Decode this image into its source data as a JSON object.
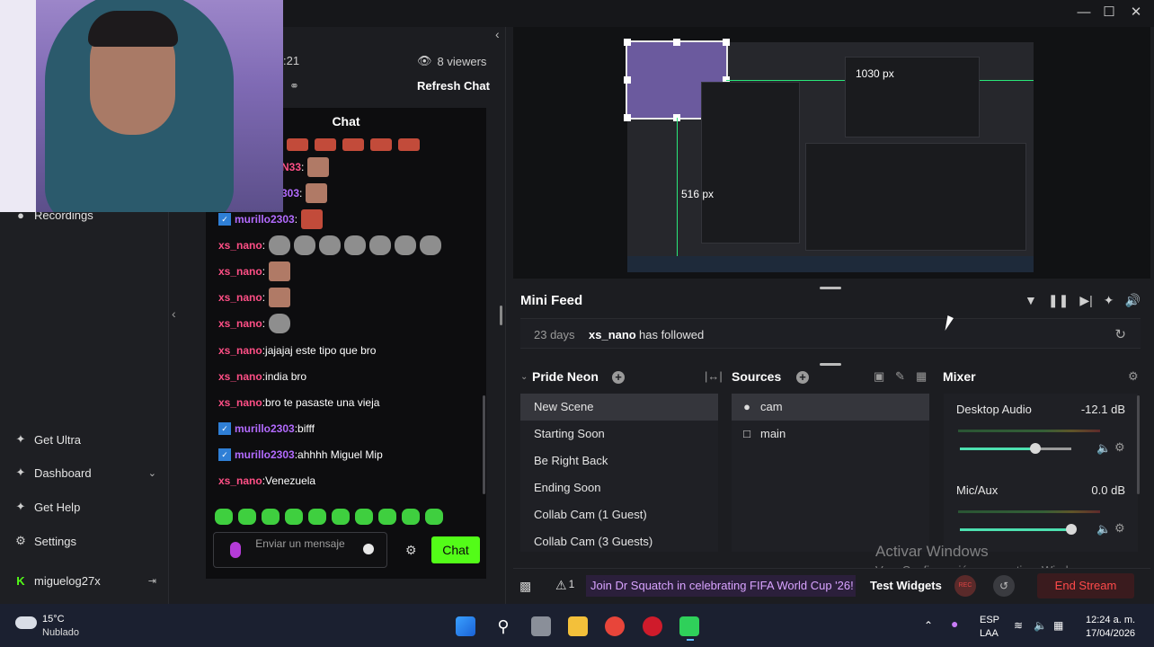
{
  "stream": {
    "time_fragment": ":21",
    "viewers": "8 viewers",
    "refresh_chat": "Refresh Chat"
  },
  "sidebar": {
    "items": [
      {
        "label": "Recordings",
        "icon": "record-icon"
      },
      {
        "label": "Get Ultra",
        "icon": "ultra-icon"
      },
      {
        "label": "Dashboard",
        "icon": "dashboard-icon"
      },
      {
        "label": "Get Help",
        "icon": "help-icon"
      },
      {
        "label": "Settings",
        "icon": "gear-icon"
      }
    ],
    "username": "miguelog27x"
  },
  "chat": {
    "title": "Chat",
    "messages": [
      {
        "user": "N33",
        "text": ""
      },
      {
        "user": "303",
        "text": ""
      },
      {
        "user": "murillo2303",
        "text": ""
      },
      {
        "user": "xs_nano",
        "text": ""
      },
      {
        "user": "xs_nano",
        "text": ""
      },
      {
        "user": "xs_nano",
        "text": ""
      },
      {
        "user": "xs_nano",
        "text": ""
      },
      {
        "user": "xs_nano",
        "text": "jajajaj este tipo que bro"
      },
      {
        "user": "xs_nano",
        "text": "india bro"
      },
      {
        "user": "xs_nano",
        "text": "bro te pasaste una vieja"
      },
      {
        "user": "murillo2303",
        "text": "bifff"
      },
      {
        "user": "murillo2303",
        "text": "ahhhh Miguel Mip"
      },
      {
        "user": "xs_nano",
        "text": "Venezuela"
      }
    ],
    "input_placeholder": "Enviar un mensaje",
    "send_label": "Chat"
  },
  "preview": {
    "label_width": "1030 px",
    "label_height": "516 px"
  },
  "mini_feed": {
    "title": "Mini Feed",
    "events": [
      {
        "time": "23 days",
        "user": "xs_nano",
        "action": "has followed"
      }
    ]
  },
  "scenes": {
    "title": "Pride Neon",
    "items": [
      "New Scene",
      "Starting Soon",
      "Be Right Back",
      "Ending Soon",
      "Collab Cam (1 Guest)",
      "Collab Cam (3 Guests)"
    ],
    "selected": "New Scene"
  },
  "sources": {
    "title": "Sources",
    "items": [
      {
        "label": "cam",
        "icon": "camera-icon"
      },
      {
        "label": "main",
        "icon": "monitor-icon"
      }
    ]
  },
  "mixer": {
    "title": "Mixer",
    "channels": [
      {
        "name": "Desktop Audio",
        "db": "-12.1 dB",
        "level": 0.68
      },
      {
        "name": "Mic/Aux",
        "db": "0.0 dB",
        "level": 1.0
      }
    ]
  },
  "bottom": {
    "alerts_count": "1",
    "ticker": "Join Dr Squatch in celebrating FIFA World Cup '26!",
    "test_widgets": "Test Widgets",
    "rec": "REC",
    "end_stream": "End Stream"
  },
  "watermark": {
    "title": "Activar Windows",
    "subtitle": "Ve a Configuración para activar Windows."
  },
  "taskbar": {
    "temperature": "15°C",
    "weather": "Nublado",
    "lang1": "ESP",
    "lang2": "LAA",
    "time": "12:24 a. m.",
    "date": "17/04/2026"
  },
  "colors": {
    "accent_green": "#53fc18",
    "chat_user_red": "#ff4f86",
    "chat_user_purple": "#b36bff",
    "end_stream": "#ff4a4a"
  }
}
